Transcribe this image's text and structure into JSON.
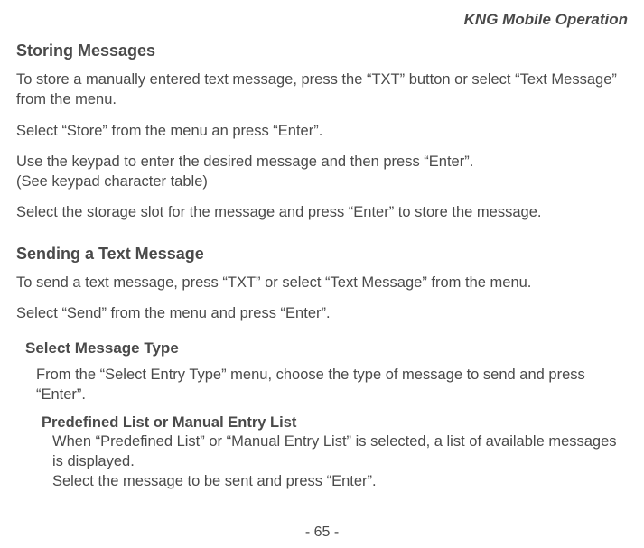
{
  "header": {
    "right_title": "KNG Mobile Operation"
  },
  "section1": {
    "title": "Storing Messages",
    "p1": "To store a manually entered text message, press the “TXT” button or select “Text Message” from the menu.",
    "p2": "Select “Store” from the menu an press “Enter”.",
    "p3a": "Use the keypad to enter the desired message and then press “Enter”.",
    "p3b": "(See keypad character table)",
    "p4": "Select the storage slot for the message and press “Enter” to store the message."
  },
  "section2": {
    "title": "Sending a Text Message",
    "p1": "To send a text message, press “TXT” or select “Text Message” from the menu.",
    "p2": "Select “Send” from the menu and press “Enter”."
  },
  "section3": {
    "title": "Select Message Type",
    "p1": "From the “Select Entry Type” menu, choose the type of message to send and press “Enter”.",
    "sub_title": "Predefined List or Manual Entry List",
    "sub_p1": "When “Predefined List” or “Manual Entry List” is selected, a list of available messages is displayed.",
    "sub_p2": "Select the message to be sent and press “Enter”."
  },
  "footer": {
    "page_number": "- 65 -"
  }
}
